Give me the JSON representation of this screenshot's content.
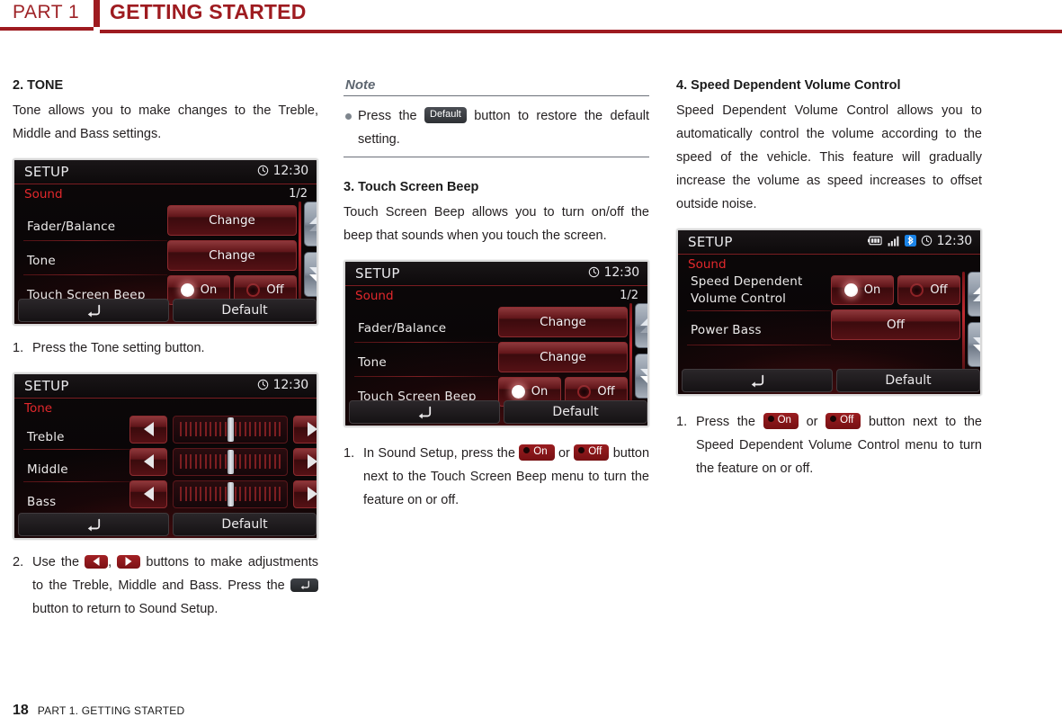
{
  "header": {
    "part": "PART 1",
    "title": "GETTING STARTED"
  },
  "footer": {
    "page": "18",
    "text": "PART 1. GETTING STARTED"
  },
  "col1": {
    "section_title": "2. TONE",
    "section_body": "Tone allows you to make changes to the Treble, Middle and Bass settings.",
    "step1": {
      "num": "1.",
      "text": "Press the Tone setting button."
    },
    "step2": {
      "num": "2.",
      "t1": "Use the ",
      "t2": ", ",
      "t3": " buttons to make adjustments to the Treble, Middle and Bass. Press the ",
      "t4": " button to return to Sound Setup."
    }
  },
  "col2": {
    "note_title": "Note",
    "note_t1": "Press the ",
    "note_pill": "Default",
    "note_t2": " button to restore the default setting.",
    "section_title": "3. Touch Screen Beep",
    "section_body": "Touch Screen Beep allows you to turn on/off the beep that sounds when you touch the screen.",
    "step1": {
      "num": "1.",
      "t1": "In Sound Setup, press the ",
      "on": "On",
      "t2": " or ",
      "off": "Off",
      "t3": " button next to the Touch Screen Beep menu to turn the feature on or off."
    }
  },
  "col3": {
    "section_title": "4. Speed Dependent Volume Control",
    "section_body": "Speed Dependent Volume Control allows you to automatically control the volume according to the speed of the vehicle. This feature will gradually increase the volume as speed increases to offset outside noise.",
    "step1": {
      "num": "1.",
      "t1": "Press the ",
      "on": "On",
      "t2": " or ",
      "off": "Off",
      "t3": " button next to the Speed Dependent Volume Control menu to turn the feature on or off."
    }
  },
  "screen_sound": {
    "title": "SETUP",
    "clock": "12:30",
    "category": "Sound",
    "page": "1/2",
    "rows": [
      {
        "label": "Fader/Balance",
        "button": "Change"
      },
      {
        "label": "Tone",
        "button": "Change"
      },
      {
        "label": "Touch Screen Beep",
        "on": "On",
        "off": "Off"
      }
    ],
    "bottom": {
      "back_icon": "back-arrow-icon",
      "default": "Default"
    },
    "scroll_up_icon": "double-chevron-up-icon",
    "scroll_down_icon": "double-chevron-down-icon"
  },
  "screen_tone": {
    "title": "SETUP",
    "clock": "12:30",
    "category": "Tone",
    "rows": [
      {
        "label": "Treble"
      },
      {
        "label": "Middle"
      },
      {
        "label": "Bass"
      }
    ],
    "bottom": {
      "back_icon": "back-arrow-icon",
      "default": "Default"
    }
  },
  "screen_sdvc": {
    "title": "SETUP",
    "clock": "12:30",
    "category": "Sound",
    "status_icons": [
      "battery-icon",
      "signal-bars-icon",
      "bluetooth-icon",
      "clock-icon"
    ],
    "rows": [
      {
        "label_line1": "Speed Dependent",
        "label_line2": "Volume Control",
        "on": "On",
        "off": "Off"
      },
      {
        "label": "Power Bass",
        "button": "Off"
      }
    ],
    "bottom": {
      "back_icon": "back-arrow-icon",
      "default": "Default"
    },
    "scroll_up_icon": "double-chevron-up-icon",
    "scroll_down_icon": "double-chevron-down-icon"
  },
  "colors": {
    "brand_red": "#9e1b20",
    "screen_red": "#e2282c",
    "note_gray": "#5d6670"
  }
}
